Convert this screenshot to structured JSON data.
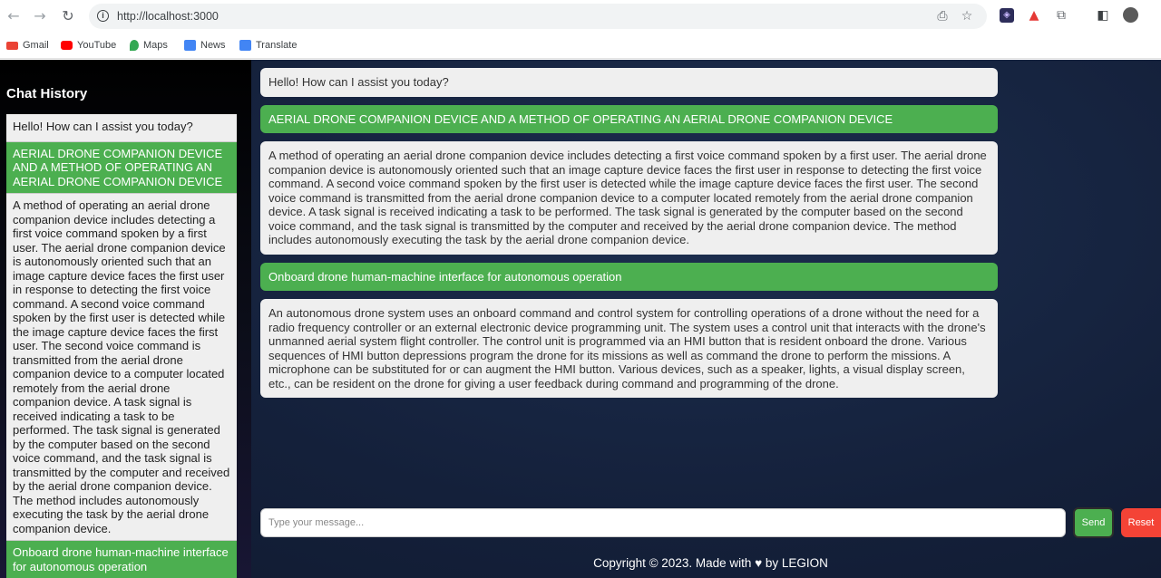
{
  "browser": {
    "url": "http://localhost:3000",
    "bookmarks": [
      {
        "label": "Gmail",
        "color": "#ea4335"
      },
      {
        "label": "YouTube",
        "color": "#ff0000"
      },
      {
        "label": "Maps",
        "color": "#34a853"
      },
      {
        "label": "News",
        "color": "#4285f4"
      },
      {
        "label": "Translate",
        "color": "#4285f4"
      }
    ]
  },
  "sidebar": {
    "title": "Chat History",
    "items": [
      {
        "role": "ai",
        "text": "Hello! How can I assist you today?"
      },
      {
        "role": "user",
        "text": "AERIAL DRONE COMPANION DEVICE AND A METHOD OF OPERATING AN AERIAL DRONE COMPANION DEVICE"
      },
      {
        "role": "ai",
        "text": "A method of operating an aerial drone companion device includes detecting a first voice command spoken by a first user. The aerial drone companion device is autonomously oriented such that an image capture device faces the first user in response to detecting the first voice command. A second voice command spoken by the first user is detected while the image capture device faces the first user. The second voice command is transmitted from the aerial drone companion device to a computer located remotely from the aerial drone companion device. A task signal is received indicating a task to be performed. The task signal is generated by the computer based on the second voice command, and the task signal is transmitted by the computer and received by the aerial drone companion device. The method includes autonomously executing the task by the aerial drone companion device."
      },
      {
        "role": "user",
        "text": "Onboard drone human-machine interface for autonomous operation"
      }
    ]
  },
  "messages": [
    {
      "role": "ai",
      "text": "Hello! How can I assist you today?"
    },
    {
      "role": "user",
      "text": "AERIAL DRONE COMPANION DEVICE AND A METHOD OF OPERATING AN AERIAL DRONE COMPANION DEVICE"
    },
    {
      "role": "ai",
      "text": "A method of operating an aerial drone companion device includes detecting a first voice command spoken by a first user. The aerial drone companion device is autonomously oriented such that an image capture device faces the first user in response to detecting the first voice command. A second voice command spoken by the first user is detected while the image capture device faces the first user. The second voice command is transmitted from the aerial drone companion device to a computer located remotely from the aerial drone companion device. A task signal is received indicating a task to be performed. The task signal is generated by the computer based on the second voice command, and the task signal is transmitted by the computer and received by the aerial drone companion device. The method includes autonomously executing the task by the aerial drone companion device."
    },
    {
      "role": "user",
      "text": "Onboard drone human-machine interface for autonomous operation"
    },
    {
      "role": "ai",
      "text": "An autonomous drone system uses an onboard command and control system for controlling operations of a drone without the need for a radio frequency controller or an external electronic device programming unit. The system uses a control unit that interacts with the drone's unmanned aerial system flight controller. The control unit is programmed via an HMI button that is resident onboard the drone. Various sequences of HMI button depressions program the drone for its missions as well as command the drone to perform the missions. A microphone can be substituted for or can augment the HMI button. Various devices, such as a speaker, lights, a visual display screen, etc., can be resident on the drone for giving a user feedback during command and programming of the drone."
    }
  ],
  "composer": {
    "placeholder": "Type your message...",
    "send_label": "Send",
    "reset_label": "Reset"
  },
  "footer": "Copyright © 2023. Made with ♥ by LEGION",
  "colors": {
    "accent": "#4caf50",
    "danger": "#f44336",
    "bubble": "#efefef"
  }
}
